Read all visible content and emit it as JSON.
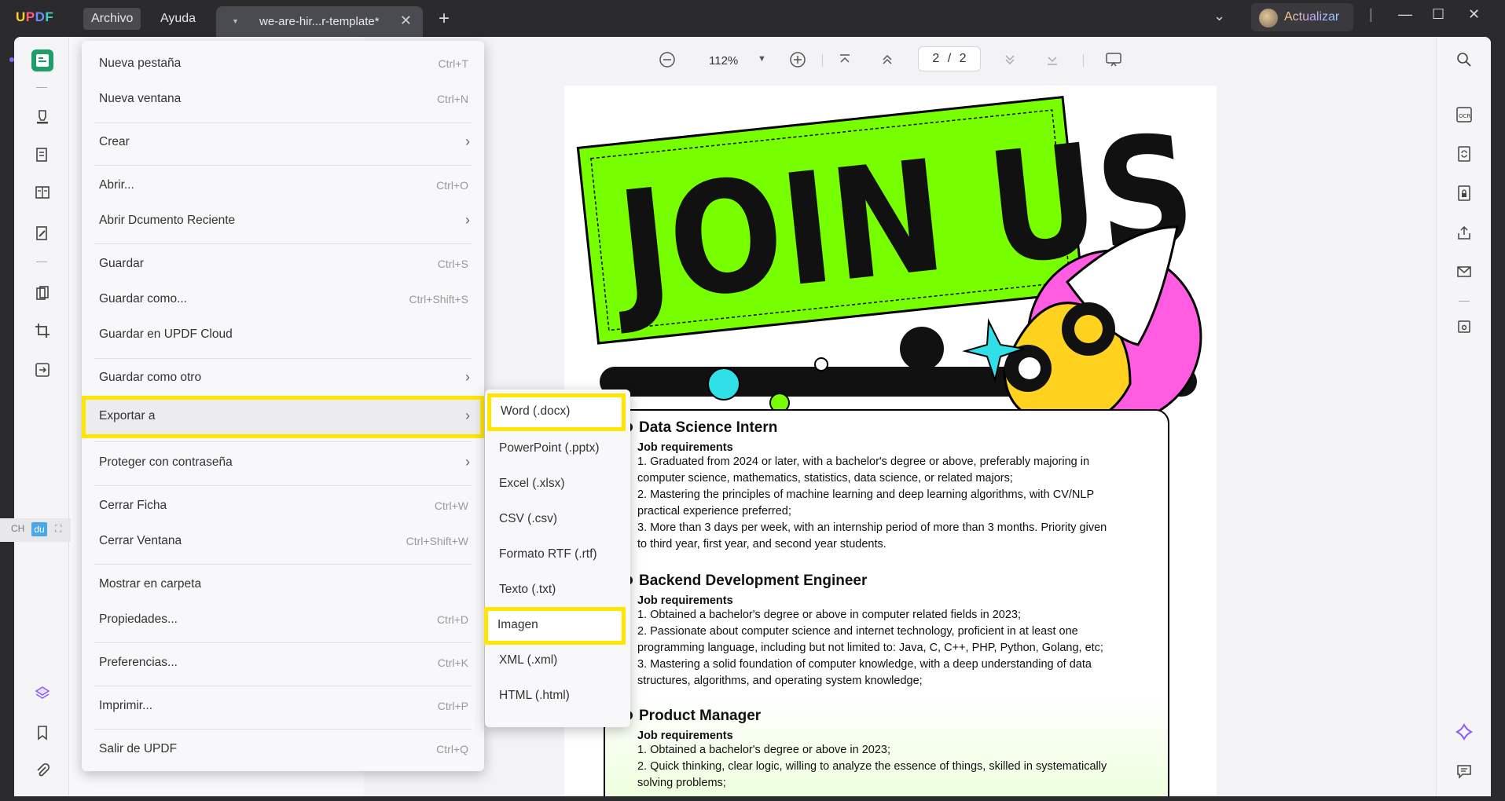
{
  "app": {
    "logo": "UPDF",
    "menus": [
      "Archivo",
      "Ayuda"
    ],
    "tab_title": "we-are-hir...r-template*",
    "upgrade_label": "Actualizar"
  },
  "toolbar": {
    "zoom": "112%",
    "page_current": "2",
    "page_total": "2",
    "page_sep": "/"
  },
  "archivo_menu": [
    {
      "label": "Nueva pestaña",
      "shortcut": "Ctrl+T"
    },
    {
      "label": "Nueva ventana",
      "shortcut": "Ctrl+N"
    },
    {
      "label": "Crear",
      "shortcut": ""
    },
    {
      "label": "Abrir...",
      "shortcut": "Ctrl+O"
    },
    {
      "label": "Abrir Dcumento Reciente",
      "shortcut": ""
    },
    {
      "label": "Guardar",
      "shortcut": "Ctrl+S"
    },
    {
      "label": "Guardar como...",
      "shortcut": "Ctrl+Shift+S"
    },
    {
      "label": "Guardar en UPDF Cloud",
      "shortcut": ""
    },
    {
      "label": "Guardar como otro",
      "shortcut": ""
    },
    {
      "label": "Exportar a",
      "shortcut": ""
    },
    {
      "label": "Proteger con contraseña",
      "shortcut": ""
    },
    {
      "label": "Cerrar Ficha",
      "shortcut": "Ctrl+W"
    },
    {
      "label": "Cerrar Ventana",
      "shortcut": "Ctrl+Shift+W"
    },
    {
      "label": "Mostrar en carpeta",
      "shortcut": ""
    },
    {
      "label": "Propiedades...",
      "shortcut": "Ctrl+D"
    },
    {
      "label": "Preferencias...",
      "shortcut": "Ctrl+K"
    },
    {
      "label": "Imprimir...",
      "shortcut": "Ctrl+P"
    },
    {
      "label": "Salir de UPDF",
      "shortcut": "Ctrl+Q"
    }
  ],
  "export_menu": [
    "Word (.docx)",
    "PowerPoint (.pptx)",
    "Excel (.xlsx)",
    "CSV (.csv)",
    "Formato RTF (.rtf)",
    "Texto (.txt)",
    "Imagen",
    "XML (.xml)",
    "HTML (.html)"
  ],
  "document": {
    "banner": "JOIN US",
    "jobs": [
      {
        "title": "Data Science Intern",
        "req_label": "Job requirements",
        "lines": [
          "1. Graduated from 2024 or later, with a bachelor's degree or above, preferably majoring in",
          "computer science, mathematics, statistics, data science, or related majors;",
          "2. Mastering the principles of machine learning and deep learning algorithms, with CV/NLP",
          "practical experience preferred;",
          "3. More than 3 days per week, with an internship period of more than 3 months. Priority given",
          "to third year, first year, and second year students."
        ]
      },
      {
        "title": "Backend Development Engineer",
        "req_label": "Job requirements",
        "lines": [
          "1. Obtained a bachelor's degree or above in computer related fields in 2023;",
          "2. Passionate about computer science and internet technology, proficient in at least one",
          "programming language, including but not limited to: Java, C, C++, PHP, Python, Golang, etc;",
          "3. Mastering a solid foundation of computer knowledge, with a deep understanding of data",
          "structures, algorithms, and operating system knowledge;"
        ]
      },
      {
        "title": "Product Manager",
        "req_label": "Job requirements",
        "lines": [
          "1. Obtained a bachelor's degree or above in 2023;",
          "2. Quick thinking, clear logic, willing to analyze the essence of things, skilled in systematically",
          "solving problems;"
        ]
      }
    ]
  },
  "ime": {
    "a": "CH",
    "b": "du"
  },
  "colors": {
    "highlight": "#ffe600",
    "poster_green": "#77ff00",
    "accent": "#1f9e6a"
  }
}
